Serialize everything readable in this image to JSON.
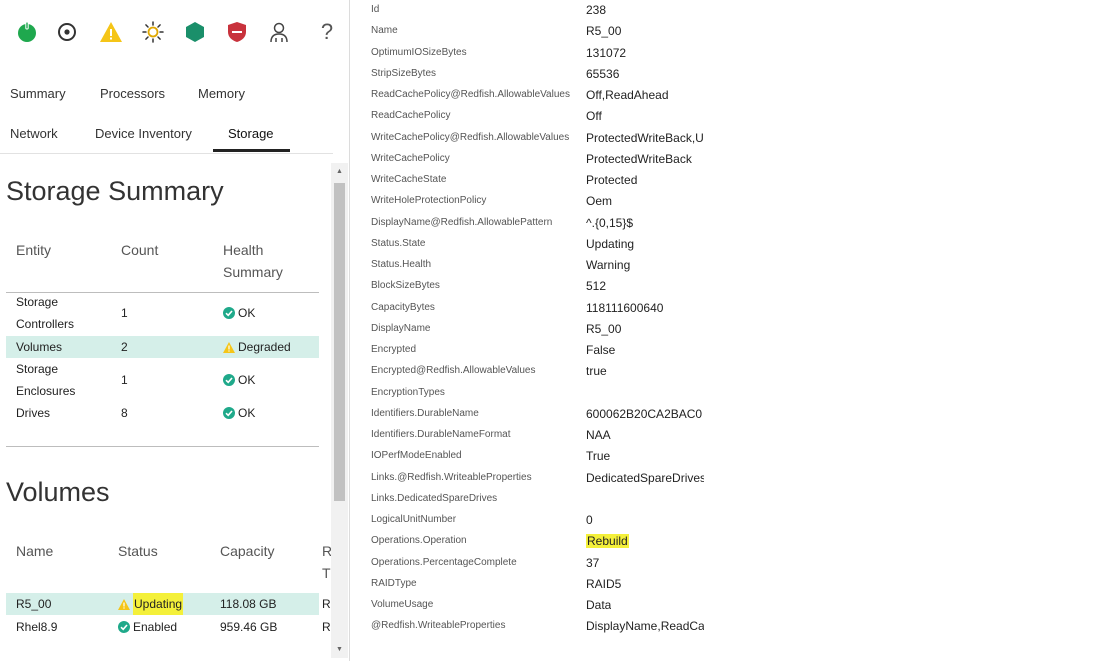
{
  "toolbar": {
    "icons": [
      "power-icon",
      "target-icon",
      "warning-icon",
      "sun-icon",
      "hexagon-icon",
      "shield-icon",
      "user-icon",
      "help-icon"
    ],
    "help_label": "?"
  },
  "tabs": {
    "row1": [
      "Summary",
      "Processors",
      "Memory"
    ],
    "row2": [
      "Network",
      "Device Inventory",
      "Storage"
    ],
    "active": "Storage"
  },
  "storage_summary": {
    "title": "Storage Summary",
    "headers": {
      "entity": "Entity",
      "count": "Count",
      "health_line1": "Health",
      "health_line2": "Summary"
    },
    "rows": [
      {
        "entity_l1": "Storage",
        "entity_l2": "Controllers",
        "count": "1",
        "health": "OK",
        "health_status": "ok"
      },
      {
        "entity_l1": "Volumes",
        "entity_l2": "",
        "count": "2",
        "health": "Degraded",
        "health_status": "warning"
      },
      {
        "entity_l1": "Storage",
        "entity_l2": "Enclosures",
        "count": "1",
        "health": "OK",
        "health_status": "ok"
      },
      {
        "entity_l1": "Drives",
        "entity_l2": "",
        "count": "8",
        "health": "OK",
        "health_status": "ok"
      }
    ]
  },
  "volumes": {
    "title": "Volumes",
    "headers": {
      "name": "Name",
      "status": "Status",
      "capacity": "Capacity",
      "raid_l1": "R",
      "raid_l2": "T"
    },
    "rows": [
      {
        "name": "R5_00",
        "status": "Updating",
        "status_icon": "warning",
        "capacity": "118.08 GB",
        "raid": "R"
      },
      {
        "name": "Rhel8.9",
        "status": "Enabled",
        "status_icon": "ok",
        "capacity": "959.46 GB",
        "raid": "R"
      }
    ]
  },
  "properties": [
    {
      "key": "Id",
      "value": "238"
    },
    {
      "key": "Name",
      "value": "R5_00"
    },
    {
      "key": "OptimumIOSizeBytes",
      "value": "131072"
    },
    {
      "key": "StripSizeBytes",
      "value": "65536"
    },
    {
      "key": "ReadCachePolicy@Redfish.AllowableValues",
      "value": "Off,ReadAhead"
    },
    {
      "key": "ReadCachePolicy",
      "value": "Off"
    },
    {
      "key": "WriteCachePolicy@Redfish.AllowableValues",
      "value": "ProtectedWriteBack,U"
    },
    {
      "key": "WriteCachePolicy",
      "value": "ProtectedWriteBack"
    },
    {
      "key": "WriteCacheState",
      "value": "Protected"
    },
    {
      "key": "WriteHoleProtectionPolicy",
      "value": "Oem"
    },
    {
      "key": "DisplayName@Redfish.AllowablePattern",
      "value": "^.{0,15}$"
    },
    {
      "key": "Status.State",
      "value": "Updating"
    },
    {
      "key": "Status.Health",
      "value": "Warning"
    },
    {
      "key": "BlockSizeBytes",
      "value": "512"
    },
    {
      "key": "CapacityBytes",
      "value": "118111600640"
    },
    {
      "key": "DisplayName",
      "value": "R5_00"
    },
    {
      "key": "Encrypted",
      "value": "False"
    },
    {
      "key": "Encrypted@Redfish.AllowableValues",
      "value": "true"
    },
    {
      "key": "EncryptionTypes",
      "value": ""
    },
    {
      "key": "Identifiers.DurableName",
      "value": "600062B20CA2BAC0"
    },
    {
      "key": "Identifiers.DurableNameFormat",
      "value": "NAA"
    },
    {
      "key": "IOPerfModeEnabled",
      "value": "True"
    },
    {
      "key": "Links.@Redfish.WriteableProperties",
      "value": "DedicatedSpareDrives"
    },
    {
      "key": "Links.DedicatedSpareDrives",
      "value": ""
    },
    {
      "key": "LogicalUnitNumber",
      "value": "0"
    },
    {
      "key": "Operations.Operation",
      "value": "Rebuild",
      "highlight": true
    },
    {
      "key": "Operations.PercentageComplete",
      "value": "37"
    },
    {
      "key": "RAIDType",
      "value": "RAID5"
    },
    {
      "key": "VolumeUsage",
      "value": "Data"
    },
    {
      "key": "@Redfish.WriteableProperties",
      "value": "DisplayName,ReadCac"
    }
  ],
  "colors": {
    "ok": "#1fa98a",
    "warning": "#f5c518",
    "critical": "#c8323c",
    "hexagon": "#1a8f6a",
    "power": "#1fa84e",
    "highlight_row": "#d5efe9",
    "highlight_text": "#f4f03a"
  }
}
